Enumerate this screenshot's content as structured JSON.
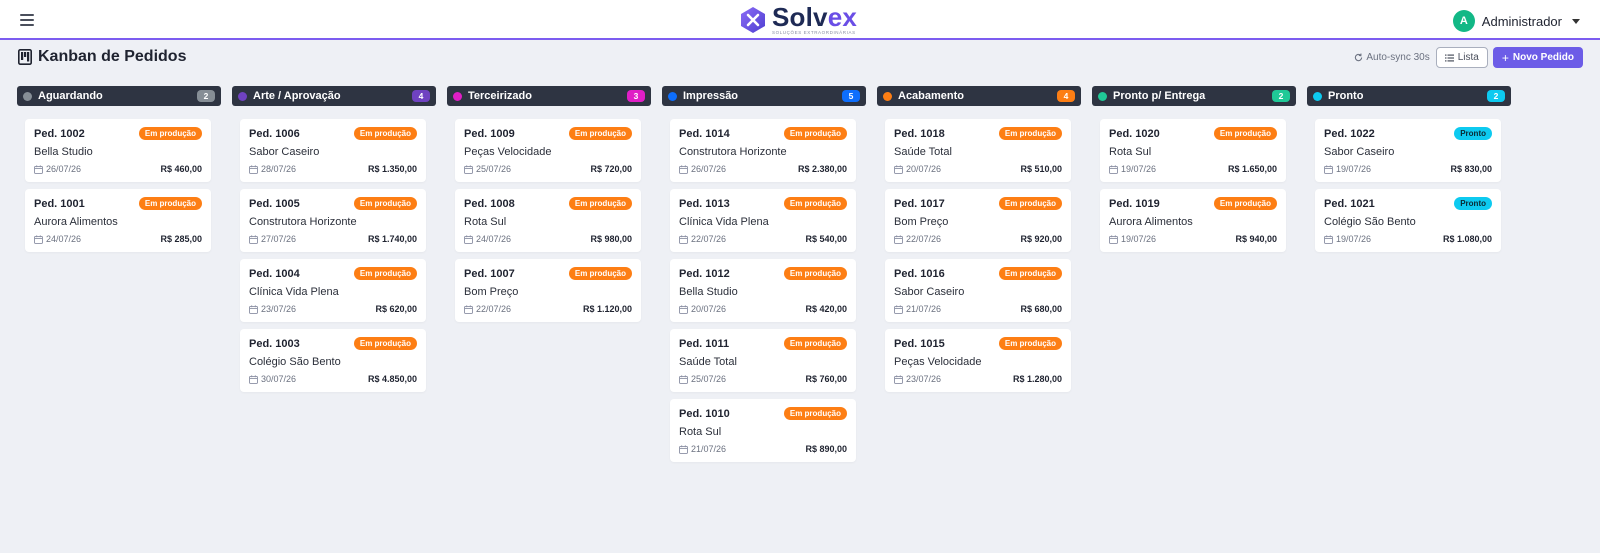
{
  "brand": {
    "word_part1": "Solv",
    "word_part2": "ex",
    "tagline": "SOLUÇÕES EXTRAORDINÁRIAS"
  },
  "user": {
    "initial": "A",
    "name": "Administrador"
  },
  "page": {
    "title": "Kanban de Pedidos"
  },
  "actions": {
    "autosync": "Auto-sync 30s",
    "list_label": "Lista",
    "new_label": "Novo Pedido"
  },
  "colors": {
    "accent": "#6c5ce7",
    "in_production": "#fd7e14",
    "ready": "#0dcaf0"
  },
  "columns": [
    {
      "title": "Aguardando",
      "count": "2",
      "color": "#868e96",
      "cards": [
        {
          "id": "Ped. 1002",
          "status": "Em produção",
          "client": "Bella Studio",
          "date": "26/07/26",
          "value": "R$ 460,00"
        },
        {
          "id": "Ped. 1001",
          "status": "Em produção",
          "client": "Aurora Alimentos",
          "date": "24/07/26",
          "value": "R$ 285,00"
        }
      ]
    },
    {
      "title": "Arte / Aprovação",
      "count": "4",
      "color": "#6f42c1",
      "cards": [
        {
          "id": "Ped. 1006",
          "status": "Em produção",
          "client": "Sabor Caseiro",
          "date": "28/07/26",
          "value": "R$ 1.350,00"
        },
        {
          "id": "Ped. 1005",
          "status": "Em produção",
          "client": "Construtora Horizonte",
          "date": "27/07/26",
          "value": "R$ 1.740,00"
        },
        {
          "id": "Ped. 1004",
          "status": "Em produção",
          "client": "Clínica Vida Plena",
          "date": "23/07/26",
          "value": "R$ 620,00"
        },
        {
          "id": "Ped. 1003",
          "status": "Em produção",
          "client": "Colégio São Bento",
          "date": "30/07/26",
          "value": "R$ 4.850,00"
        }
      ]
    },
    {
      "title": "Terceirizado",
      "count": "3",
      "color": "#e01ec6",
      "cards": [
        {
          "id": "Ped. 1009",
          "status": "Em produção",
          "client": "Peças Velocidade",
          "date": "25/07/26",
          "value": "R$ 720,00"
        },
        {
          "id": "Ped. 1008",
          "status": "Em produção",
          "client": "Rota Sul",
          "date": "24/07/26",
          "value": "R$ 980,00"
        },
        {
          "id": "Ped. 1007",
          "status": "Em produção",
          "client": "Bom Preço",
          "date": "22/07/26",
          "value": "R$ 1.120,00"
        }
      ]
    },
    {
      "title": "Impressão",
      "count": "5",
      "color": "#0d6efd",
      "cards": [
        {
          "id": "Ped. 1014",
          "status": "Em produção",
          "client": "Construtora Horizonte",
          "date": "26/07/26",
          "value": "R$ 2.380,00"
        },
        {
          "id": "Ped. 1013",
          "status": "Em produção",
          "client": "Clínica Vida Plena",
          "date": "22/07/26",
          "value": "R$ 540,00"
        },
        {
          "id": "Ped. 1012",
          "status": "Em produção",
          "client": "Bella Studio",
          "date": "20/07/26",
          "value": "R$ 420,00"
        },
        {
          "id": "Ped. 1011",
          "status": "Em produção",
          "client": "Saúde Total",
          "date": "25/07/26",
          "value": "R$ 760,00"
        },
        {
          "id": "Ped. 1010",
          "status": "Em produção",
          "client": "Rota Sul",
          "date": "21/07/26",
          "value": "R$ 890,00"
        }
      ]
    },
    {
      "title": "Acabamento",
      "count": "4",
      "color": "#fd7e14",
      "cards": [
        {
          "id": "Ped. 1018",
          "status": "Em produção",
          "client": "Saúde Total",
          "date": "20/07/26",
          "value": "R$ 510,00"
        },
        {
          "id": "Ped. 1017",
          "status": "Em produção",
          "client": "Bom Preço",
          "date": "22/07/26",
          "value": "R$ 920,00"
        },
        {
          "id": "Ped. 1016",
          "status": "Em produção",
          "client": "Sabor Caseiro",
          "date": "21/07/26",
          "value": "R$ 680,00"
        },
        {
          "id": "Ped. 1015",
          "status": "Em produção",
          "client": "Peças Velocidade",
          "date": "23/07/26",
          "value": "R$ 1.280,00"
        }
      ]
    },
    {
      "title": "Pronto p/ Entrega",
      "count": "2",
      "color": "#20c997",
      "cards": [
        {
          "id": "Ped. 1020",
          "status": "Em produção",
          "client": "Rota Sul",
          "date": "19/07/26",
          "value": "R$ 1.650,00"
        },
        {
          "id": "Ped. 1019",
          "status": "Em produção",
          "client": "Aurora Alimentos",
          "date": "19/07/26",
          "value": "R$ 940,00"
        }
      ]
    },
    {
      "title": "Pronto",
      "count": "2",
      "color": "#0dcaf0",
      "cards": [
        {
          "id": "Ped. 1022",
          "status": "Pronto",
          "client": "Sabor Caseiro",
          "date": "19/07/26",
          "value": "R$ 830,00"
        },
        {
          "id": "Ped. 1021",
          "status": "Pronto",
          "client": "Colégio São Bento",
          "date": "19/07/26",
          "value": "R$ 1.080,00"
        }
      ]
    }
  ]
}
